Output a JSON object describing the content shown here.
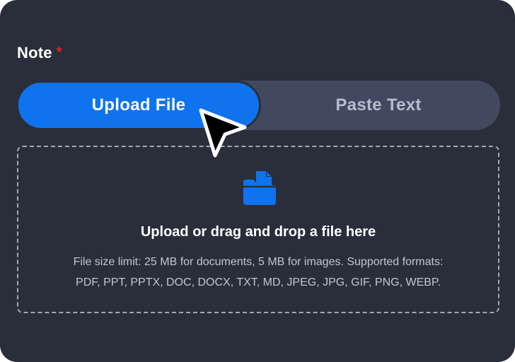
{
  "field": {
    "label": "Note",
    "required_mark": "*"
  },
  "tabs": [
    {
      "label": "Upload File",
      "selected": true
    },
    {
      "label": "Paste Text",
      "selected": false
    }
  ],
  "dropzone": {
    "icon": "folder-document-icon",
    "title": "Upload or drag and drop a file here",
    "hint_line1": "File size limit: 25 MB for documents, 5 MB for images. Supported formats:",
    "hint_line2": "PDF, PPT, PPTX, DOC, DOCX, TXT, MD, JPEG, JPG, GIF, PNG, WEBP."
  },
  "colors": {
    "background": "#2a2e3b",
    "accent": "#0f73ee",
    "required": "#e02424",
    "segment_track": "#424860"
  },
  "cursor": {
    "icon": "mouse-pointer-icon"
  }
}
